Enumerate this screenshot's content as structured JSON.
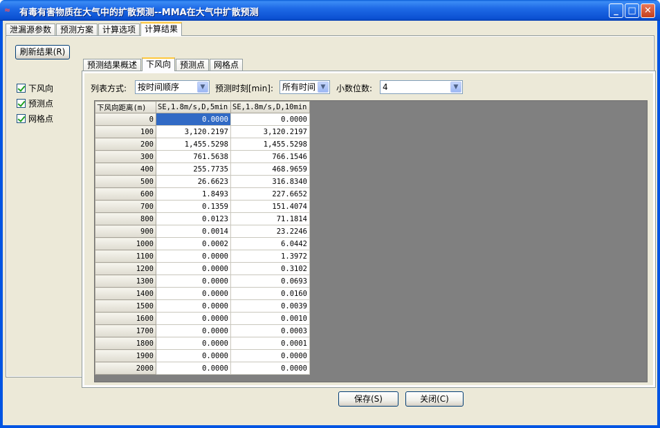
{
  "window": {
    "title": "有毒有害物质在大气中的扩散预测--MMA在大气中扩散预测",
    "app_icon": "app-logo-icon",
    "controls": [
      "minimize",
      "maximize",
      "close"
    ]
  },
  "main_tabs": [
    {
      "label": "泄漏源参数",
      "active": false
    },
    {
      "label": "预测方案",
      "active": false
    },
    {
      "label": "计算选项",
      "active": false
    },
    {
      "label": "计算结果",
      "active": true
    }
  ],
  "left": {
    "refresh_label": "刷新结果(R)",
    "checks": [
      {
        "label": "下风向",
        "checked": true
      },
      {
        "label": "预测点",
        "checked": true
      },
      {
        "label": "网格点",
        "checked": true
      }
    ]
  },
  "sub_tabs": [
    {
      "label": "预测结果概述",
      "active": false
    },
    {
      "label": "下风向",
      "active": true
    },
    {
      "label": "预测点",
      "active": false
    },
    {
      "label": "网格点",
      "active": false
    }
  ],
  "filters": {
    "list_mode_label": "列表方式:",
    "list_mode_value": "按时间顺序",
    "time_label": "预测时刻[min]:",
    "time_value": "所有时间",
    "decimals_label": "小数位数:",
    "decimals_value": "4"
  },
  "table": {
    "headers": [
      "下风向距离(m)",
      "SE,1.8m/s,D,5min",
      "SE,1.8m/s,D,10min"
    ],
    "rows": [
      [
        "0",
        "0.0000",
        "0.0000"
      ],
      [
        "100",
        "3,120.2197",
        "3,120.2197"
      ],
      [
        "200",
        "1,455.5298",
        "1,455.5298"
      ],
      [
        "300",
        "761.5638",
        "766.1546"
      ],
      [
        "400",
        "255.7735",
        "468.9659"
      ],
      [
        "500",
        "26.6623",
        "316.8340"
      ],
      [
        "600",
        "1.8493",
        "227.6652"
      ],
      [
        "700",
        "0.1359",
        "151.4074"
      ],
      [
        "800",
        "0.0123",
        "71.1814"
      ],
      [
        "900",
        "0.0014",
        "23.2246"
      ],
      [
        "1000",
        "0.0002",
        "6.0442"
      ],
      [
        "1100",
        "0.0000",
        "1.3972"
      ],
      [
        "1200",
        "0.0000",
        "0.3102"
      ],
      [
        "1300",
        "0.0000",
        "0.0693"
      ],
      [
        "1400",
        "0.0000",
        "0.0160"
      ],
      [
        "1500",
        "0.0000",
        "0.0039"
      ],
      [
        "1600",
        "0.0000",
        "0.0010"
      ],
      [
        "1700",
        "0.0000",
        "0.0003"
      ],
      [
        "1800",
        "0.0000",
        "0.0001"
      ],
      [
        "1900",
        "0.0000",
        "0.0000"
      ],
      [
        "2000",
        "0.0000",
        "0.0000"
      ]
    ]
  },
  "footer": {
    "save_label": "保存(S)",
    "close_label": "关闭(C)"
  }
}
